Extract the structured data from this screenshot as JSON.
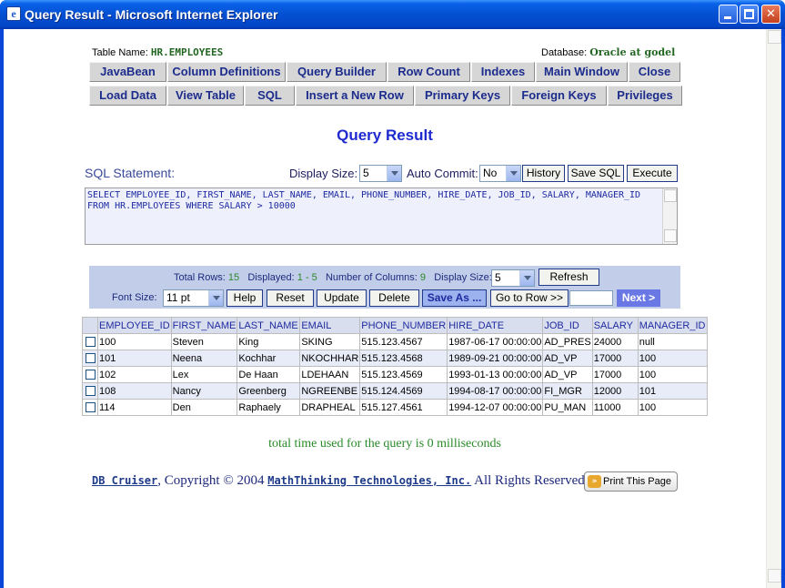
{
  "window": {
    "title": "Query Result - Microsoft Internet Explorer"
  },
  "header": {
    "table_name_label": "Table Name:",
    "table_name_value": "HR.EMPLOYEES",
    "database_label": "Database:",
    "database_value": "Oracle at godel"
  },
  "nav_row1": [
    "JavaBean",
    "Column Definitions",
    "Query Builder",
    "Row Count",
    "Indexes",
    "Main Window",
    "Close"
  ],
  "nav_row2": [
    "Load Data",
    "View Table",
    "SQL",
    "Insert a New Row",
    "Primary Keys",
    "Foreign Keys",
    "Privileges"
  ],
  "page_title": "Query Result",
  "sql": {
    "label": "SQL Statement:",
    "display_size_label": "Display Size:",
    "display_size_value": "5",
    "auto_commit_label": "Auto Commit:",
    "auto_commit_value": "No",
    "history_label": "History",
    "save_sql_label": "Save SQL",
    "execute_label": "Execute",
    "statement": "SELECT EMPLOYEE_ID, FIRST_NAME, LAST_NAME, EMAIL, PHONE_NUMBER, HIRE_DATE, JOB_ID, SALARY, MANAGER_ID FROM HR.EMPLOYEES WHERE SALARY > 10000"
  },
  "toolbar": {
    "total_rows_label": "Total Rows:",
    "total_rows_value": "15",
    "displayed_label": "Displayed:",
    "displayed_value": "1 - 5",
    "num_columns_label": "Number of Columns:",
    "num_columns_value": "9",
    "display_size_label": "Display Size:",
    "display_size_value": "5",
    "refresh_label": "Refresh",
    "font_size_label": "Font Size:",
    "font_size_value": "11 pt",
    "help_label": "Help",
    "reset_label": "Reset",
    "update_label": "Update",
    "delete_label": "Delete",
    "save_as_label": "Save As ...",
    "goto_row_label": "Go to Row >>",
    "goto_row_value": "",
    "next_label": "Next >"
  },
  "table": {
    "columns": [
      "EMPLOYEE_ID",
      "FIRST_NAME",
      "LAST_NAME",
      "EMAIL",
      "PHONE_NUMBER",
      "HIRE_DATE",
      "JOB_ID",
      "SALARY",
      "MANAGER_ID"
    ],
    "rows": [
      [
        "100",
        "Steven",
        "King",
        "SKING",
        "515.123.4567",
        "1987-06-17 00:00:00",
        "AD_PRES",
        "24000",
        "null"
      ],
      [
        "101",
        "Neena",
        "Kochhar",
        "NKOCHHAR",
        "515.123.4568",
        "1989-09-21 00:00:00",
        "AD_VP",
        "17000",
        "100"
      ],
      [
        "102",
        "Lex",
        "De Haan",
        "LDEHAAN",
        "515.123.4569",
        "1993-01-13 00:00:00",
        "AD_VP",
        "17000",
        "100"
      ],
      [
        "108",
        "Nancy",
        "Greenberg",
        "NGREENBE",
        "515.124.4569",
        "1994-08-17 00:00:00",
        "FI_MGR",
        "12000",
        "101"
      ],
      [
        "114",
        "Den",
        "Raphaely",
        "DRAPHEAL",
        "515.127.4561",
        "1994-12-07 00:00:00",
        "PU_MAN",
        "11000",
        "100"
      ]
    ]
  },
  "time_text": "total time used for the query is 0 milliseconds",
  "footer": {
    "product_link": "DB Cruiser",
    "copyright": ",  Copyright © 2004",
    "company_link": "MathThinking Technologies, Inc.",
    "rights": "All Rights Reserved.",
    "print_label": "Print This Page"
  },
  "colors": {
    "title_blue": "#1E2AD0",
    "green_value": "#2A8A2A",
    "panel": "#C2CDEA",
    "next_button": "#6A78E6"
  },
  "icons": {
    "ie": "ie-icon",
    "print": "print-arrow-icon"
  }
}
